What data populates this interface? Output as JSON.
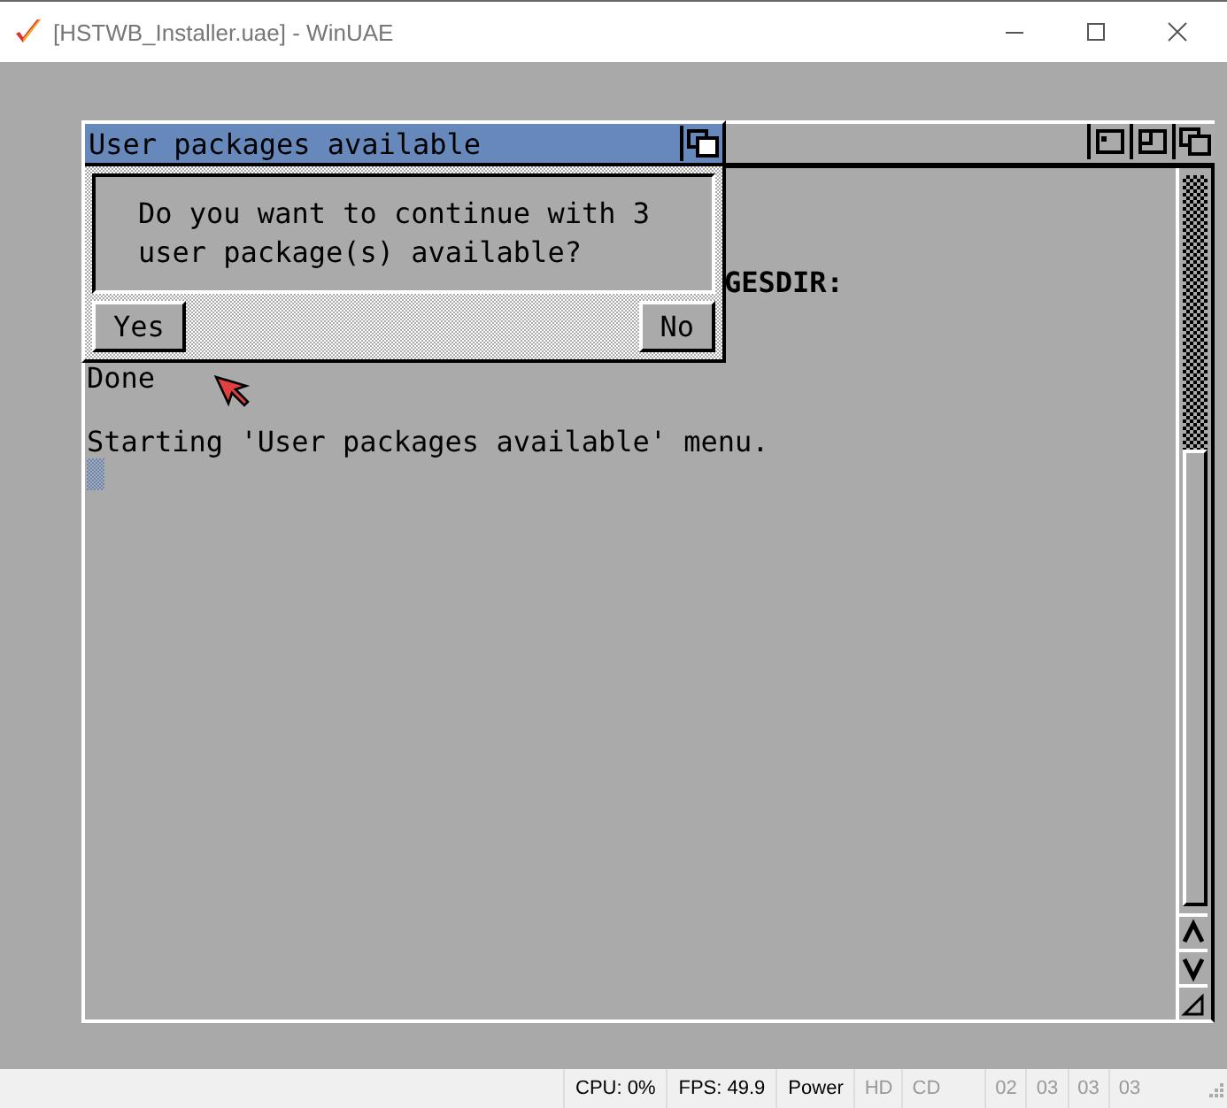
{
  "window": {
    "title": "[HSTWB_Installer.uae] - WinUAE"
  },
  "console": {
    "lines": [
      {
        "kind": "cut",
        "text": "GESDIR:"
      },
      {
        "kind": "blank"
      },
      {
        "kind": "blank"
      },
      {
        "kind": "line",
        "text": "Done"
      },
      {
        "kind": "blank"
      },
      {
        "kind": "line",
        "text": "Starting 'User packages available' menu."
      }
    ]
  },
  "dialog": {
    "title": "User packages available",
    "message": "Do you want to continue with 3\nuser package(s) available?",
    "buttons": [
      "Yes",
      "No"
    ]
  },
  "status_bar": [
    {
      "text": "CPU: 0%",
      "on": true
    },
    {
      "text": "FPS: 49.9",
      "on": true
    },
    {
      "text": "Power",
      "on": true
    },
    {
      "text": "HD",
      "on": false
    },
    {
      "text": "CD",
      "on": false
    },
    {
      "text": "02",
      "on": false
    },
    {
      "text": "03",
      "on": false
    },
    {
      "text": "03",
      "on": false
    },
    {
      "text": "03",
      "on": false
    }
  ]
}
